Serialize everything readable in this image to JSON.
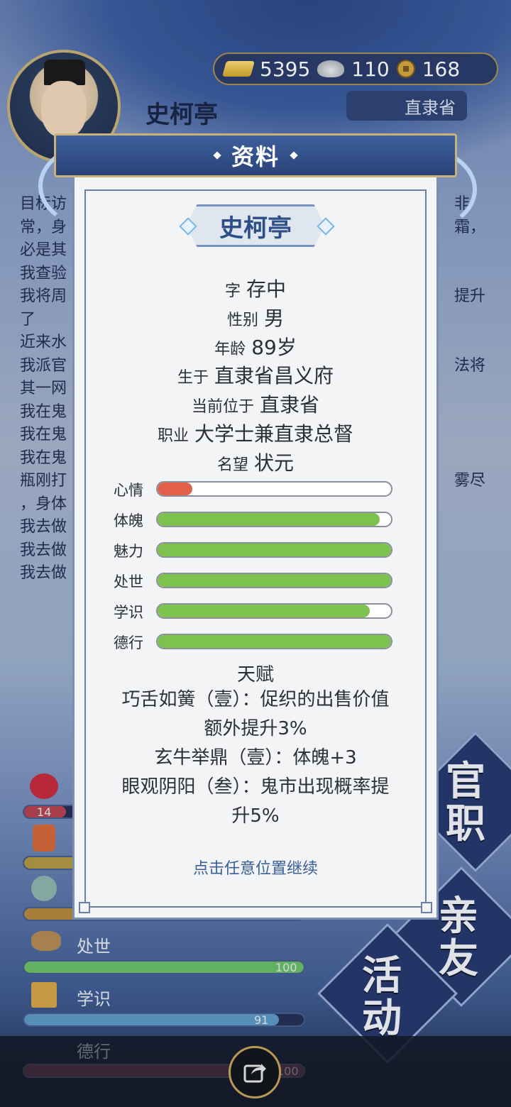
{
  "background": {
    "resources": {
      "gold": "5395",
      "silver": "110",
      "coins": "168"
    },
    "character_name": "史柯亭",
    "province": "直隶省",
    "log_fragments_left": [
      "目标访",
      "常，身",
      "必是其",
      "我查验",
      "我将周",
      "了",
      "近来水",
      "我派官",
      "其一网",
      "我在鬼",
      "我在鬼",
      "我在鬼",
      "瓶刚打",
      "，身体",
      "我去做",
      "我去做",
      "我去做"
    ],
    "log_fragments_right": [
      "非",
      "霜，",
      "",
      "",
      "提升",
      "",
      "",
      "法将",
      "",
      "",
      "",
      "",
      "雾尽",
      "",
      "",
      "",
      ""
    ],
    "stats": [
      {
        "label": "",
        "value": "14"
      },
      {
        "label": "",
        "value": ""
      },
      {
        "label": "",
        "value": ""
      },
      {
        "label": "处世",
        "value": "100"
      },
      {
        "label": "学识",
        "value": "91"
      },
      {
        "label": "德行",
        "value": "100"
      }
    ],
    "side_buttons": [
      "官职",
      "亲友",
      "活动"
    ]
  },
  "dialog": {
    "title": "资料",
    "name": "史柯亭",
    "info": [
      {
        "key": "字",
        "value": "存中"
      },
      {
        "key": "性别",
        "value": "男"
      },
      {
        "key": "年龄",
        "value": "89岁"
      },
      {
        "key": "生于",
        "value": "直隶省昌义府"
      },
      {
        "key": "当前位于",
        "value": "直隶省"
      },
      {
        "key": "职业",
        "value": "大学士兼直隶总督"
      },
      {
        "key": "名望",
        "value": "状元"
      }
    ],
    "attributes": [
      {
        "label": "心情",
        "fraction": 0.15,
        "color": "#e2604a"
      },
      {
        "label": "体魄",
        "fraction": 0.95,
        "color": "#7dc14e"
      },
      {
        "label": "魅力",
        "fraction": 1.0,
        "color": "#7dc14e"
      },
      {
        "label": "处世",
        "fraction": 1.0,
        "color": "#7dc14e"
      },
      {
        "label": "学识",
        "fraction": 0.91,
        "color": "#7dc14e"
      },
      {
        "label": "德行",
        "fraction": 1.0,
        "color": "#7dc14e"
      }
    ],
    "talent_title": "天赋",
    "talents": [
      "巧舌如簧（壹）：促织的出售价值",
      "额外提升3%",
      "玄牛举鼎（壹）：体魄+3",
      "眼观阴阳（叁）：鬼市出现概率提",
      "升5%"
    ],
    "continue_hint": "点击任意位置继续"
  },
  "colors": {
    "accent": "#2d4f86",
    "mood_bar": "#e2604a",
    "good_bar": "#7dc14e"
  }
}
